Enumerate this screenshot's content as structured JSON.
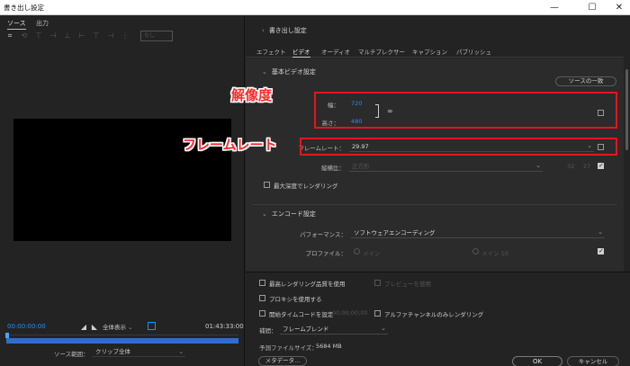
{
  "window": {
    "title": "書き出し設定",
    "minimize_glyph": "—",
    "maximize_glyph": "☐",
    "close_glyph": "✕"
  },
  "left_panel": {
    "tabs": [
      {
        "label": "ソース",
        "active": true
      },
      {
        "label": "出力",
        "active": false
      }
    ],
    "toolbar_icons": [
      "crop-icon",
      "rotate-icon",
      "align-top-icon",
      "align-middle-icon",
      "align-bottom-icon",
      "align-left-icon",
      "align-center-icon",
      "align-right-icon",
      "distribute-icon"
    ],
    "ratio_select": "なし",
    "current_time": "00:00:00:00",
    "zoom_select": "全体表示",
    "duration": "01:43:33:00",
    "source_range_label": "ソース範囲：",
    "source_range_value": "クリップ全体",
    "playhead_fraction": 0.0
  },
  "right_panel": {
    "export_settings_header": "書き出し設定",
    "tabs": [
      {
        "label": "エフェクト",
        "active": false
      },
      {
        "label": "ビデオ",
        "active": true
      },
      {
        "label": "オーディオ",
        "active": false
      },
      {
        "label": "マルチプレクサー",
        "active": false
      },
      {
        "label": "キャプション",
        "active": false
      },
      {
        "label": "パブリッシュ",
        "active": false
      }
    ],
    "basic_video": {
      "header": "基本ビデオ設定",
      "match_source_button": "ソースの一致",
      "width_label": "幅：",
      "width_value": "720",
      "height_label": "高さ：",
      "height_value": "480",
      "frame_rate_label": "フレームレート：",
      "frame_rate_value": "29.97",
      "aspect_label": "縦横比：",
      "aspect_value": "正方形",
      "aspect_w": "32",
      "aspect_h": "27",
      "max_depth_label": "最大深度でレンダリング"
    },
    "encode": {
      "header": "エンコード設定",
      "performance_label": "パフォーマンス：",
      "performance_value": "ソフトウェアエンコーディング",
      "profile_label": "プロファイル：",
      "profile_option_1": "メイン",
      "profile_option_2": "メイン 10"
    },
    "lower": {
      "max_render_quality": "最高レンダリング品質を使用",
      "use_preview": "プレビューを使用",
      "use_proxy": "プロキシを使用する",
      "start_timecode": "開始タイムコードを設定",
      "start_timecode_value": "00;00;00;00",
      "alpha_only": "アルファチャンネルのみレンダリング",
      "interpolation_label": "補間：",
      "interpolation_value": "フレームブレンド",
      "file_size_label": "予測ファイルサイズ：",
      "file_size_value": "5684 MB",
      "metadata_button": "メタデータ...",
      "ok_button": "OK",
      "cancel_button": "キャンセル"
    }
  },
  "annotations": {
    "resolution_label": "解像度",
    "framerate_label": "フレームレート",
    "highlight_color": "#e8141b"
  }
}
